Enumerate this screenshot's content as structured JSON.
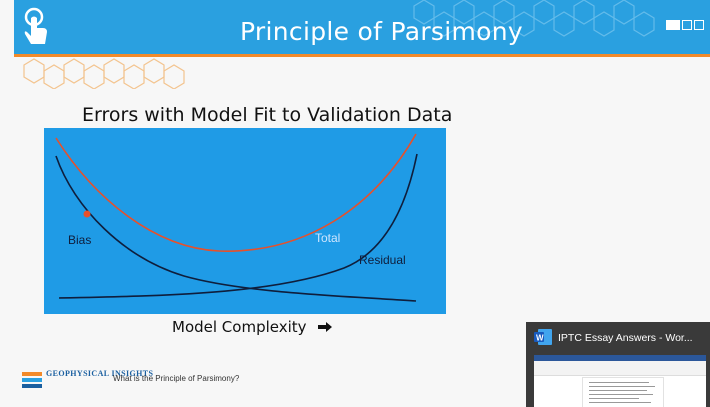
{
  "slide": {
    "title": "Principle of Parsimony",
    "heading": "Errors with Model Fit to Validation Data",
    "x_axis_label": "Model Complexity",
    "footer_question": "What is the Principle of Parsimony?",
    "logo_text": "GEOPHYSICAL INSIGHTS"
  },
  "chart": {
    "background": "#1f9be6",
    "curve_labels": {
      "bias": "Bias",
      "total": "Total",
      "residual": "Residual"
    },
    "colors": {
      "bias": "#0f1e3c",
      "total": "#e8502a",
      "residual": "#0f1e3c",
      "total_label": "#cfe6ff",
      "marker": "#e8502a"
    }
  },
  "taskbar_preview": {
    "title": "IPTC Essay Answers - Wor...",
    "app_icon": "word-icon"
  },
  "colors": {
    "banner": "#2aa0e0",
    "accent": "#f28a2a"
  }
}
